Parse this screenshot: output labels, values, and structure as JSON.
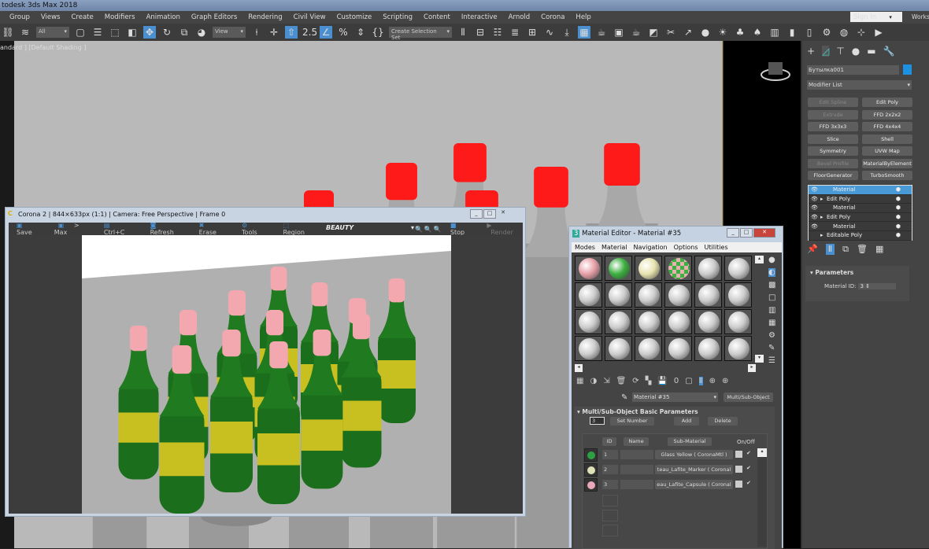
{
  "app": {
    "title": "todesk 3ds Max 2018"
  },
  "menu": [
    "Group",
    "Views",
    "Create",
    "Modifiers",
    "Animation",
    "Graph Editors",
    "Rendering",
    "Civil View",
    "Customize",
    "Scripting",
    "Content",
    "Interactive",
    "Arnold",
    "Corona",
    "Help"
  ],
  "account": {
    "signin": "Sign In",
    "workspace": "Works"
  },
  "toolbar": {
    "filter": "All",
    "refcoord": "View",
    "selection_set": "Create Selection Set",
    "snap": "2.5"
  },
  "viewport": {
    "label": "andard ] [Default Shading ]"
  },
  "right_panel": {
    "object_name": "Бутылка001",
    "object_color": "#1e90e0",
    "modifier_list": "Modifier List",
    "modifiers": [
      {
        "label": "Edit Spline",
        "enabled": false
      },
      {
        "label": "Edit Poly",
        "enabled": true
      },
      {
        "label": "Extrude",
        "enabled": false
      },
      {
        "label": "FFD 2x2x2",
        "enabled": true
      },
      {
        "label": "FFD 3x3x3",
        "enabled": true
      },
      {
        "label": "FFD 4x4x4",
        "enabled": true
      },
      {
        "label": "Slice",
        "enabled": true
      },
      {
        "label": "Shell",
        "enabled": true
      },
      {
        "label": "Symmetry",
        "enabled": true
      },
      {
        "label": "UVW Map",
        "enabled": true
      },
      {
        "label": "Bevel Profile",
        "enabled": false
      },
      {
        "label": "MaterialByElement",
        "enabled": true
      },
      {
        "label": "FloorGenerator",
        "enabled": true
      },
      {
        "label": "TurboSmooth",
        "enabled": true
      }
    ],
    "stack": [
      {
        "label": "Material",
        "selected": true,
        "expand": false
      },
      {
        "label": "Edit Poly",
        "expand": true
      },
      {
        "label": "Material",
        "expand": false
      },
      {
        "label": "Edit Poly",
        "expand": true
      },
      {
        "label": "Material",
        "expand": false
      },
      {
        "label": "Editable Poly",
        "expand": true
      }
    ],
    "parameters": {
      "title": "Parameters",
      "material_id_label": "Material ID:",
      "material_id": "3"
    }
  },
  "corona": {
    "title": "Corona 2 | 844×633px (1:1) | Camera: Free Perspective | Frame 0",
    "tools": {
      "save": "Save",
      "max": "> Max",
      "copy": "Ctrl+C",
      "refresh": "Refresh",
      "erase": "Erase",
      "tools": "Tools",
      "region": "Region",
      "channel": "BEAUTY",
      "stop": "Stop",
      "render": "Render"
    }
  },
  "material_editor": {
    "title": "Material Editor - Material #35",
    "menu": [
      "Modes",
      "Material",
      "Navigation",
      "Options",
      "Utilities"
    ],
    "slot_colors": [
      "#e8a0a8",
      "#3cb040",
      "#e8e4b0",
      "checker",
      "#ccc",
      "#ccc"
    ],
    "material_name": "Material #35",
    "material_type": "Multi/Sub-Object",
    "rollout": "Multi/Sub-Object Basic Parameters",
    "count": "3",
    "set_number": "Set Number",
    "add": "Add",
    "delete": "Delete",
    "headers": {
      "id": "ID",
      "name": "Name",
      "sub": "Sub-Material",
      "onoff": "On/Off"
    },
    "rows": [
      {
        "id": "1",
        "sub": "Glass Yellow  ( CoronaMtl )",
        "color": "#2ea040"
      },
      {
        "id": "2",
        "sub": "teau_Lafite_Marker  ( Coronal",
        "color": "#e0e0b8"
      },
      {
        "id": "3",
        "sub": "eau_Lafite_Capsule  ( Coronal",
        "color": "#e8a8b8"
      }
    ]
  }
}
